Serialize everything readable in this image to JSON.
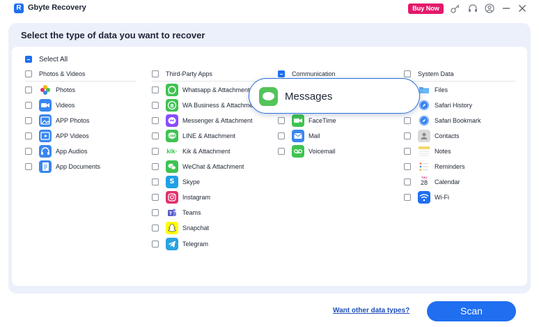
{
  "app": {
    "title": "Gbyte Recovery",
    "logo_letter": "R",
    "buy_now": "Buy Now"
  },
  "page": {
    "title": "Select the type of data you want to recover",
    "select_all": "Select All"
  },
  "columns": [
    {
      "header": "Photos & Videos",
      "header_checked": false,
      "items": [
        {
          "label": "Photos",
          "icon": "photos-icon",
          "color": "#ffffff",
          "checked": false
        },
        {
          "label": "Videos",
          "icon": "videos-icon",
          "color": "#3a86f0",
          "checked": false
        },
        {
          "label": "APP Photos",
          "icon": "app-photos-icon",
          "color": "#3a86f0",
          "checked": false
        },
        {
          "label": "APP Videos",
          "icon": "app-videos-icon",
          "color": "#3a86f0",
          "checked": false
        },
        {
          "label": "App Audios",
          "icon": "app-audios-icon",
          "color": "#3a86f0",
          "checked": false
        },
        {
          "label": "App Documents",
          "icon": "app-documents-icon",
          "color": "#3a86f0",
          "checked": false
        }
      ]
    },
    {
      "header": "Third-Party Apps",
      "header_checked": false,
      "items": [
        {
          "label": "Whatsapp & Attachment",
          "icon": "whatsapp-icon",
          "color": "#3fc351",
          "checked": false
        },
        {
          "label": "WA Business & Attachment",
          "icon": "wa-business-icon",
          "color": "#3fc351",
          "checked": false
        },
        {
          "label": "Messenger & Attachment",
          "icon": "messenger-icon",
          "color": "#8a4dff",
          "checked": false
        },
        {
          "label": "LINE & Attachment",
          "icon": "line-icon",
          "color": "#3fc351",
          "checked": false
        },
        {
          "label": "Kik & Attachment",
          "icon": "kik-icon",
          "color": "#ffffff",
          "checked": false
        },
        {
          "label": "WeChat & Attachment",
          "icon": "wechat-icon",
          "color": "#3fc351",
          "checked": false
        },
        {
          "label": "Skype",
          "icon": "skype-icon",
          "color": "#1ea0e6",
          "checked": false
        },
        {
          "label": "Instagram",
          "icon": "instagram-icon",
          "color": "#e2306c",
          "checked": false
        },
        {
          "label": "Teams",
          "icon": "teams-icon",
          "color": "#5b5fc7",
          "checked": false
        },
        {
          "label": "Snapchat",
          "icon": "snapchat-icon",
          "color": "#fffc00",
          "checked": false
        },
        {
          "label": "Telegram",
          "icon": "telegram-icon",
          "color": "#2aa3df",
          "checked": false
        }
      ]
    },
    {
      "header": "Communication",
      "header_checked": true,
      "items": [
        {
          "label": "FaceTime",
          "icon": "facetime-icon",
          "color": "#3fc351",
          "checked": false
        },
        {
          "label": "Mail",
          "icon": "mail-icon",
          "color": "#3a86f0",
          "checked": false
        },
        {
          "label": "Voicemail",
          "icon": "voicemail-icon",
          "color": "#3fc351",
          "checked": false
        }
      ]
    },
    {
      "header": "System Data",
      "header_checked": false,
      "items": [
        {
          "label": "Files",
          "icon": "files-icon",
          "color": "#4aa3f0",
          "checked": false
        },
        {
          "label": "Safari History",
          "icon": "safari-history-icon",
          "color": "#3a86f0",
          "checked": false
        },
        {
          "label": "Safari Bookmark",
          "icon": "safari-bookmark-icon",
          "color": "#3a86f0",
          "checked": false
        },
        {
          "label": "Contacts",
          "icon": "contacts-icon",
          "color": "#c9c9c9",
          "checked": false
        },
        {
          "label": "Notes",
          "icon": "notes-icon",
          "color": "#f5d86a",
          "checked": false
        },
        {
          "label": "Reminders",
          "icon": "reminders-icon",
          "color": "#ffffff",
          "checked": false
        },
        {
          "label": "Calendar",
          "icon": "calendar-icon",
          "color": "#ffffff",
          "checked": false
        },
        {
          "label": "Wi-Fi",
          "icon": "wifi-icon",
          "color": "#1f6ff0",
          "checked": false
        }
      ]
    }
  ],
  "calendar_icon": {
    "month": "THU",
    "day": "28"
  },
  "popup": {
    "label": "Messages",
    "icon": "messages-icon",
    "color": "#53c45a"
  },
  "footer": {
    "more_link": "Want other data types?",
    "scan_label": "Scan"
  },
  "colors": {
    "accent": "#1f6ff0",
    "buy_now": "#e4196b",
    "panel_bg": "#ecf0fb"
  }
}
